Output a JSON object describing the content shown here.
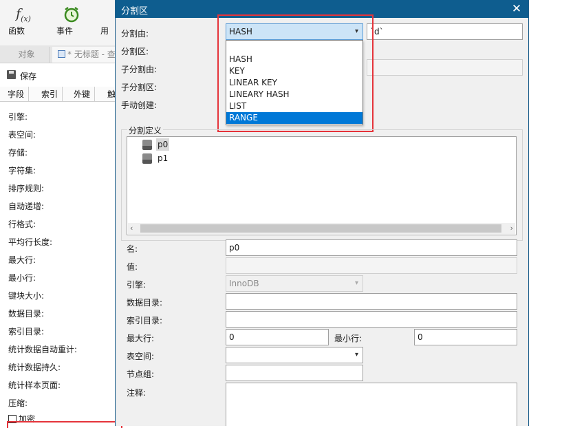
{
  "toolbar": {
    "function_label": "函数",
    "event_label": "事件",
    "partial_label": "用"
  },
  "tabs": {
    "objects": "对象",
    "untitled": "* 无标题 - 查"
  },
  "save_label": "保存",
  "subtabs": [
    "字段",
    "索引",
    "外键",
    "触"
  ],
  "options": [
    "引擎:",
    "表空间:",
    "存储:",
    "字符集:",
    "排序规则:",
    "自动递增:",
    "行格式:",
    "平均行长度:",
    "最大行:",
    "最小行:",
    "键块大小:",
    "数据目录:",
    "索引目录:",
    "统计数据自动重计:",
    "统计数据持久:",
    "统计样本页面:",
    "压缩:"
  ],
  "encrypt_label": "加密",
  "dialog": {
    "title": "分割区",
    "close": "✕",
    "partition_by_label": "分割由:",
    "partition_by_value": "HASH",
    "partition_expr": "`d`",
    "partitions_label": "分割区:",
    "subpartition_by_label": "子分割由:",
    "subpartitions_label": "子分割区:",
    "manual_create_label": "手动创建:",
    "dropdown_options": [
      "HASH",
      "KEY",
      "LINEAR KEY",
      "LINEARY HASH",
      "LIST",
      "RANGE"
    ],
    "definition_group": "分割定义",
    "tree_items": [
      "p0",
      "p1"
    ],
    "name_label": "名:",
    "name_value": "p0",
    "value_label": "值:",
    "engine_label": "引擎:",
    "engine_value": "InnoDB",
    "data_dir_label": "数据目录:",
    "index_dir_label": "索引目录:",
    "max_rows_label": "最大行:",
    "max_rows_value": "0",
    "min_rows_label": "最小行:",
    "min_rows_value": "0",
    "tablespace_label": "表空间:",
    "nodegroup_label": "节点组:",
    "comment_label": "注释:"
  },
  "icons": {
    "function": "function-icon",
    "event": "alarm-clock-icon",
    "save": "save-disk-icon",
    "partition": "partition-icon",
    "dropdown": "chevron-down-icon",
    "close": "close-icon"
  },
  "colors": {
    "titlebar": "#0e5d8f",
    "selection": "#0078d7",
    "highlight_box": "#e5333a",
    "active_combo": "#cce4f7"
  }
}
